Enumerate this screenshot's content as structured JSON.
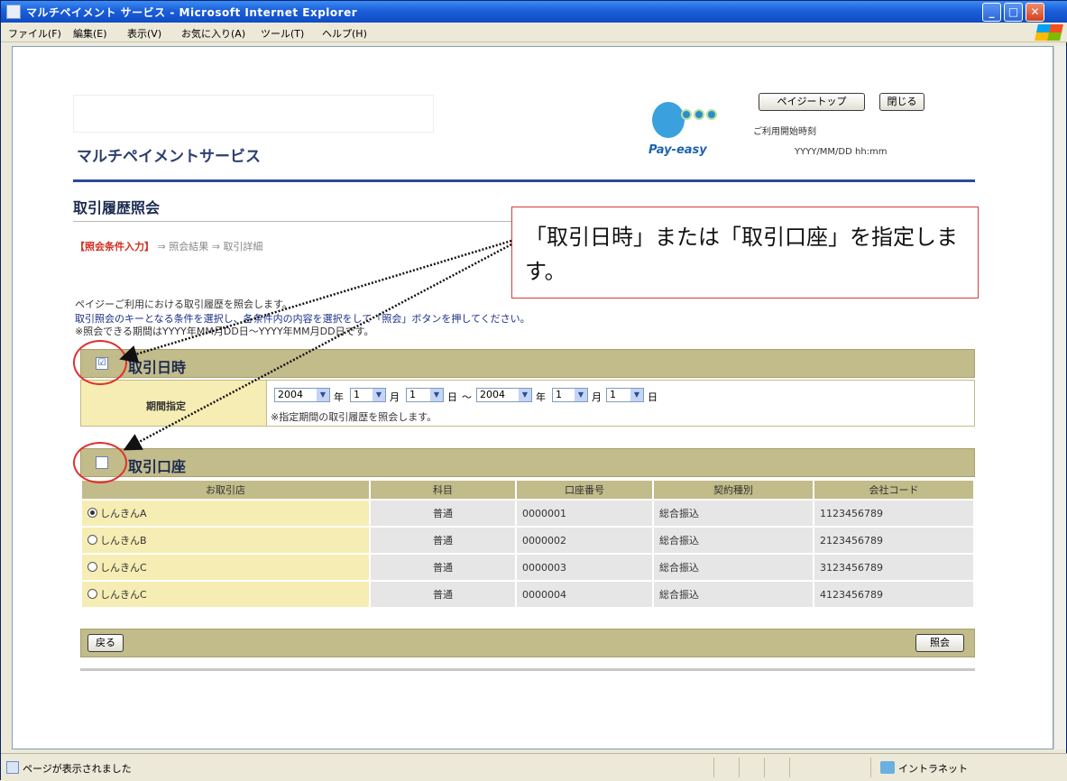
{
  "window": {
    "title": "マルチペイメント サービス - Microsoft Internet Explorer",
    "controls": {
      "minimize": "_",
      "maximize": "□",
      "close": "✕"
    }
  },
  "menu": {
    "items": [
      "ファイル(F)",
      "編集(E)",
      "表示(V)",
      "お気に入り(A)",
      "ツール(T)",
      "ヘルプ(H)"
    ]
  },
  "header": {
    "service_name": "マルチペイメントサービス",
    "logo_text": "Pay-easy",
    "top_button": "ペイジートップ",
    "close_button": "閉じる",
    "start_label": "ご利用開始時刻",
    "start_value": "YYYY/MM/DD hh:mm"
  },
  "page": {
    "title": "取引履歴照会",
    "breadcrumb": {
      "current": "【照会条件入力】",
      "sep": "⇒",
      "step2": "照会結果",
      "step3": "取引詳細"
    },
    "desc1": "ペイジーご利用における取引履歴を照会します。",
    "desc2": "取引照会のキーとなる条件を選択し、各条件内の内容を選択をして「照会」ボタンを押してください。",
    "desc3": "※照会できる期間はYYYY年MM月DD日～YYYY年MM月DD日です。"
  },
  "date_section": {
    "checked": true,
    "check_mark": "☑",
    "label": "取引日時",
    "period_label": "期間指定",
    "from": {
      "year": "2004",
      "month": "1",
      "day": "1"
    },
    "to": {
      "year": "2004",
      "month": "1",
      "day": "1"
    },
    "unit_year": "年",
    "unit_month": "月",
    "unit_day": "日",
    "tilde": "～",
    "note": "※指定期間の取引履歴を照会します。"
  },
  "account_section": {
    "checked": false,
    "label": "取引口座",
    "columns": [
      "お取引店",
      "科目",
      "口座番号",
      "契約種別",
      "会社コード"
    ],
    "rows": [
      {
        "branch": "しんきんA",
        "selected": true,
        "subject": "普通",
        "account": "0000001",
        "contract": "総合振込",
        "company": "1123456789"
      },
      {
        "branch": "しんきんB",
        "selected": false,
        "subject": "普通",
        "account": "0000002",
        "contract": "総合振込",
        "company": "2123456789"
      },
      {
        "branch": "しんきんC",
        "selected": false,
        "subject": "普通",
        "account": "0000003",
        "contract": "総合振込",
        "company": "3123456789"
      },
      {
        "branch": "しんきんC",
        "selected": false,
        "subject": "普通",
        "account": "0000004",
        "contract": "総合振込",
        "company": "4123456789"
      }
    ],
    "back_button": "戻る",
    "query_button": "照会"
  },
  "callout": {
    "text": "「取引日時」または「取引口座」を指定します。"
  },
  "statusbar": {
    "text": "ページが表示されました",
    "zone": "イントラネット"
  },
  "colors": {
    "section_header": "#c2bb8a",
    "label_cell": "#f6edb4",
    "callout_border": "#d63a3a",
    "titlebar": "#1b5fd9"
  }
}
